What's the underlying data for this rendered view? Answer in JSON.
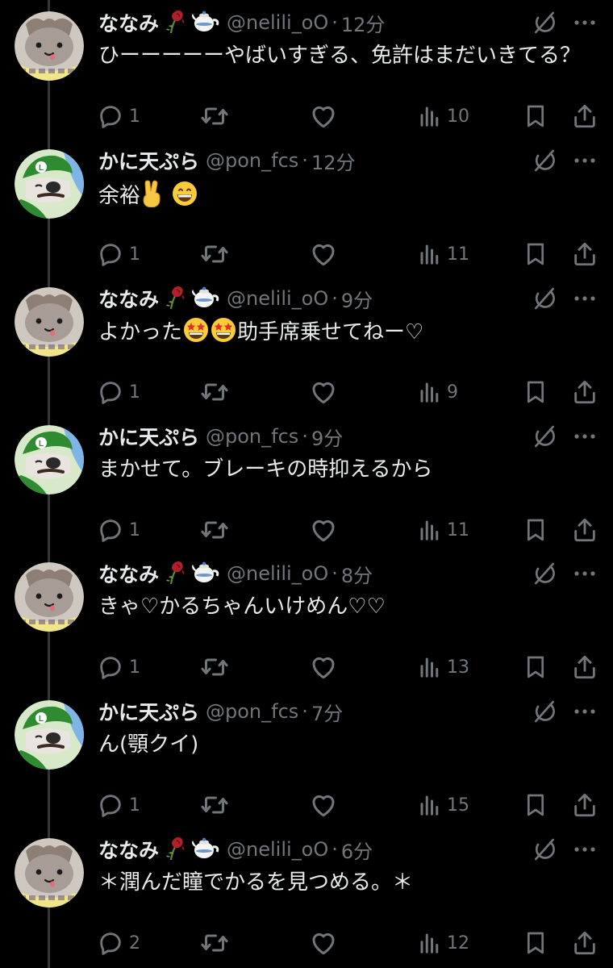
{
  "colors": {
    "background": "#000000",
    "text_primary": "#e7e9ea",
    "text_secondary": "#71767b",
    "thread_line": "#333639"
  },
  "tweets": [
    {
      "author": "ななみ",
      "author_type": "nanami",
      "decorations": [
        "wilted-rose-emoji",
        "teapot-emoji"
      ],
      "handle": "@nelili_oO",
      "dot": "·",
      "time": "12分",
      "text_parts": [
        {
          "type": "text",
          "value": "ひーーーーーやばいすぎる、免許はまだいきてる？"
        }
      ],
      "replies": "1",
      "views": "10"
    },
    {
      "author": "かに天ぷら",
      "author_type": "kani",
      "decorations": [],
      "handle": "@pon_fcs",
      "dot": "·",
      "time": "12分",
      "text_parts": [
        {
          "type": "text",
          "value": "余裕"
        },
        {
          "type": "emoji",
          "name": "victory-hand-emoji"
        },
        {
          "type": "text",
          "value": " "
        },
        {
          "type": "emoji",
          "name": "grinning-face-emoji"
        }
      ],
      "replies": "1",
      "views": "11"
    },
    {
      "author": "ななみ",
      "author_type": "nanami",
      "decorations": [
        "wilted-rose-emoji",
        "teapot-emoji"
      ],
      "handle": "@nelili_oO",
      "dot": "·",
      "time": "9分",
      "text_parts": [
        {
          "type": "text",
          "value": "よかった"
        },
        {
          "type": "emoji",
          "name": "star-struck-emoji"
        },
        {
          "type": "emoji",
          "name": "star-struck-emoji"
        },
        {
          "type": "text",
          "value": "助手席乗せてねー♡"
        }
      ],
      "replies": "1",
      "views": "9"
    },
    {
      "author": "かに天ぷら",
      "author_type": "kani",
      "decorations": [],
      "handle": "@pon_fcs",
      "dot": "·",
      "time": "9分",
      "text_parts": [
        {
          "type": "text",
          "value": "まかせて。ブレーキの時抑えるから"
        }
      ],
      "replies": "1",
      "views": "11"
    },
    {
      "author": "ななみ",
      "author_type": "nanami",
      "decorations": [
        "wilted-rose-emoji",
        "teapot-emoji"
      ],
      "handle": "@nelili_oO",
      "dot": "·",
      "time": "8分",
      "text_parts": [
        {
          "type": "text",
          "value": "きゃ♡かるちゃんいけめん♡♡"
        }
      ],
      "replies": "1",
      "views": "13"
    },
    {
      "author": "かに天ぷら",
      "author_type": "kani",
      "decorations": [],
      "handle": "@pon_fcs",
      "dot": "·",
      "time": "7分",
      "text_parts": [
        {
          "type": "text",
          "value": "ん(顎クイ)"
        }
      ],
      "replies": "1",
      "views": "15"
    },
    {
      "author": "ななみ",
      "author_type": "nanami",
      "decorations": [
        "wilted-rose-emoji",
        "teapot-emoji"
      ],
      "handle": "@nelili_oO",
      "dot": "·",
      "time": "6分",
      "text_parts": [
        {
          "type": "text",
          "value": "＊潤んだ瞳でかるを見つめる。＊"
        }
      ],
      "replies": "2",
      "views": "12"
    }
  ],
  "icons": {
    "reply": "reply-icon",
    "retweet": "retweet-icon",
    "like": "like-icon",
    "views": "views-icon",
    "bookmark": "bookmark-icon",
    "share": "share-icon",
    "grok": "grok-icon",
    "more": "more-icon"
  }
}
